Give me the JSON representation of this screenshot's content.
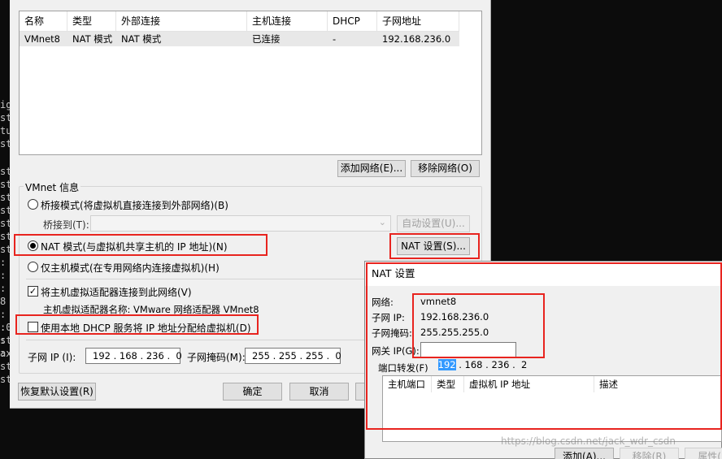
{
  "terminal": {
    "lines": [
      "ig",
      "st",
      "tu",
      "st",
      "st",
      "st",
      "st",
      "st",
      "st",
      "st",
      "st",
      ":",
      ":",
      ":",
      "8",
      ":",
      ":",
      ":",
      ":",
      ".0",
      "st",
      "ax",
      "st",
      "st"
    ]
  },
  "network_table": {
    "headers": [
      "名称",
      "类型",
      "外部连接",
      "主机连接",
      "DHCP",
      "子网地址"
    ],
    "rows": [
      [
        "VMnet8",
        "NAT 模式",
        "NAT 模式",
        "已连接",
        "-",
        "192.168.236.0"
      ]
    ]
  },
  "buttons": {
    "add_network": "添加网络(E)...",
    "remove_network": "移除网络(O)",
    "auto_settings": "自动设置(U)...",
    "nat_settings": "NAT 设置(S)...",
    "restore_defaults": "恢复默认设置(R)",
    "ok": "确定",
    "cancel": "取消"
  },
  "vmnet_info": {
    "group_title": "VMnet 信息",
    "bridge_mode": "桥接模式(将虚拟机直接连接到外部网络)(B)",
    "bridge_to_label": "桥接到(T):",
    "nat_mode": "NAT 模式(与虚拟机共享主机的 IP 地址)(N)",
    "host_only_mode": "仅主机模式(在专用网络内连接虚拟机)(H)",
    "connect_adapter": "将主机虚拟适配器连接到此网络(V)",
    "adapter_name": "主机虚拟适配器名称: VMware 网络适配器 VMnet8",
    "use_dhcp": "使用本地 DHCP 服务将 IP 地址分配给虚拟机(D)",
    "subnet_ip_label": "子网 IP (I):",
    "subnet_ip_value": "192 . 168 . 236 .  0",
    "subnet_mask_label": "子网掩码(M):",
    "subnet_mask_value": "255 . 255 . 255 .  0"
  },
  "nat_dialog": {
    "title": "NAT 设置",
    "network_label": "网络:",
    "network_value": "vmnet8",
    "subnet_ip_label": "子网 IP:",
    "subnet_ip_value": "192.168.236.0",
    "subnet_mask_label": "子网掩码:",
    "subnet_mask_value": "255.255.255.0",
    "gateway_label": "网关 IP(G):",
    "gateway_selected": "192",
    "gateway_rest": " . 168 . 236 .  2",
    "port_forward_label": "端口转发(F)",
    "pf_headers": [
      "主机端口",
      "类型",
      "虚拟机 IP 地址",
      "描述"
    ],
    "add_button": "添加(A)...",
    "remove_button": "移除(R)",
    "properties_button": "属性(P)"
  },
  "watermark": "https://blog.csdn.net/jack_wdr_csdn"
}
